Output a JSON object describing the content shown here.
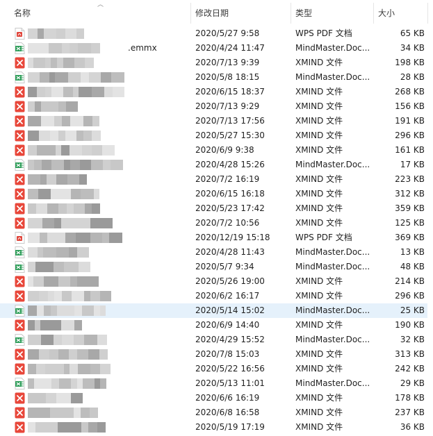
{
  "columns": {
    "name": "名称",
    "date": "修改日期",
    "type": "类型",
    "size": "大小"
  },
  "files": [
    {
      "icon": "pdf",
      "name": "",
      "date": "2020/5/27 9:58",
      "type": "WPS PDF 文档",
      "size": "65 KB"
    },
    {
      "icon": "mind",
      "name": ".emmx",
      "date": "2020/4/24 11:47",
      "type": "MindMaster.Doc...",
      "size": "34 KB"
    },
    {
      "icon": "xmind",
      "name": "",
      "date": "2020/7/13 9:39",
      "type": "XMIND 文件",
      "size": "198 KB"
    },
    {
      "icon": "mind",
      "name": "",
      "date": "2020/5/8 18:15",
      "type": "MindMaster.Doc...",
      "size": "28 KB"
    },
    {
      "icon": "xmind",
      "name": "",
      "date": "2020/6/15 18:37",
      "type": "XMIND 文件",
      "size": "268 KB"
    },
    {
      "icon": "xmind",
      "name": "",
      "date": "2020/7/13 9:29",
      "type": "XMIND 文件",
      "size": "156 KB"
    },
    {
      "icon": "xmind",
      "name": "",
      "date": "2020/7/13 17:56",
      "type": "XMIND 文件",
      "size": "191 KB"
    },
    {
      "icon": "xmind",
      "name": "",
      "date": "2020/5/27 15:30",
      "type": "XMIND 文件",
      "size": "296 KB"
    },
    {
      "icon": "xmind",
      "name": "",
      "date": "2020/6/9 9:38",
      "type": "XMIND 文件",
      "size": "161 KB"
    },
    {
      "icon": "mind",
      "name": "",
      "date": "2020/4/28 15:26",
      "type": "MindMaster.Doc...",
      "size": "17 KB"
    },
    {
      "icon": "xmind",
      "name": "",
      "date": "2020/7/2 16:19",
      "type": "XMIND 文件",
      "size": "223 KB"
    },
    {
      "icon": "xmind",
      "name": "",
      "date": "2020/6/15 16:18",
      "type": "XMIND 文件",
      "size": "312 KB"
    },
    {
      "icon": "xmind",
      "name": "",
      "date": "2020/5/23 17:42",
      "type": "XMIND 文件",
      "size": "359 KB"
    },
    {
      "icon": "xmind",
      "name": "",
      "date": "2020/7/2 10:56",
      "type": "XMIND 文件",
      "size": "125 KB"
    },
    {
      "icon": "pdf",
      "name": "",
      "date": "2020/12/19 15:18",
      "type": "WPS PDF 文档",
      "size": "369 KB"
    },
    {
      "icon": "mind",
      "name": "",
      "date": "2020/4/28 11:43",
      "type": "MindMaster.Doc...",
      "size": "13 KB"
    },
    {
      "icon": "mind",
      "name": "",
      "date": "2020/5/7 9:34",
      "type": "MindMaster.Doc...",
      "size": "48 KB"
    },
    {
      "icon": "xmind",
      "name": "",
      "date": "2020/5/26 19:00",
      "type": "XMIND 文件",
      "size": "214 KB"
    },
    {
      "icon": "xmind",
      "name": "",
      "date": "2020/6/2 16:17",
      "type": "XMIND 文件",
      "size": "296 KB"
    },
    {
      "icon": "mind",
      "name": "",
      "date": "2020/5/14 15:02",
      "type": "MindMaster.Doc...",
      "size": "25 KB",
      "selected": true
    },
    {
      "icon": "xmind",
      "name": "",
      "date": "2020/6/9 14:40",
      "type": "XMIND 文件",
      "size": "190 KB"
    },
    {
      "icon": "mind",
      "name": "",
      "date": "2020/4/29 15:52",
      "type": "MindMaster.Doc...",
      "size": "32 KB"
    },
    {
      "icon": "xmind",
      "name": "",
      "date": "2020/7/8 15:03",
      "type": "XMIND 文件",
      "size": "313 KB"
    },
    {
      "icon": "xmind",
      "name": "",
      "date": "2020/5/22 16:56",
      "type": "XMIND 文件",
      "size": "242 KB"
    },
    {
      "icon": "mind",
      "name": "",
      "date": "2020/5/13 11:01",
      "type": "MindMaster.Doc...",
      "size": "29 KB"
    },
    {
      "icon": "xmind",
      "name": "",
      "date": "2020/6/6 16:19",
      "type": "XMIND 文件",
      "size": "178 KB"
    },
    {
      "icon": "xmind",
      "name": "",
      "date": "2020/6/8 16:58",
      "type": "XMIND 文件",
      "size": "237 KB"
    },
    {
      "icon": "xmind",
      "name": "",
      "date": "2020/5/19 17:19",
      "type": "XMIND 文件",
      "size": "36 KB"
    }
  ],
  "colors": {
    "selected_row": "#e5f1fb",
    "xmind": "#e8473a",
    "pdf": "#e0463c",
    "mindmaster": "#2f9e5a"
  }
}
